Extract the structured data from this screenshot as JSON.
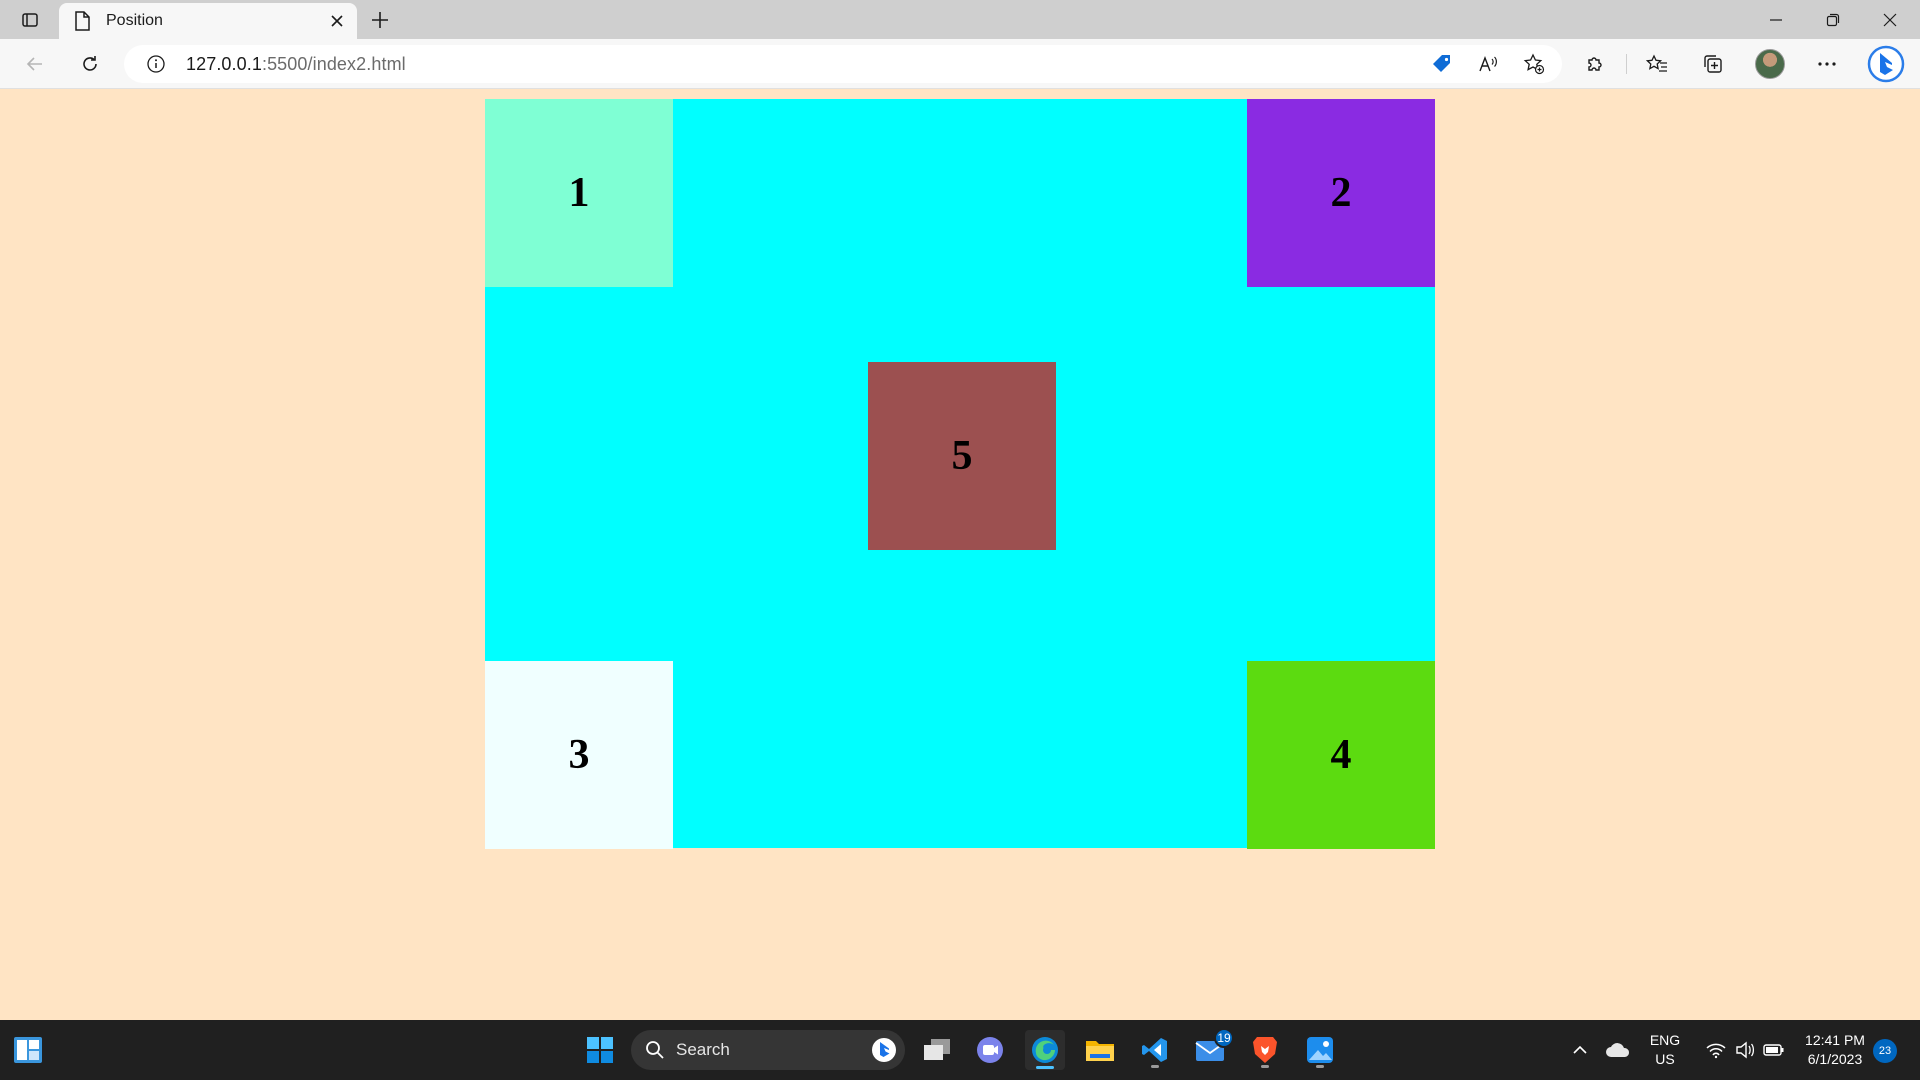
{
  "browser": {
    "tab": {
      "title": "Position"
    },
    "address": {
      "host": "127.0.0.1",
      "path": ":5500/index2.html"
    }
  },
  "page": {
    "background": "#ffe4c4",
    "container_color": "#00ffff",
    "boxes": [
      {
        "label": "1",
        "color": "#7fffd4"
      },
      {
        "label": "2",
        "color": "#8a2be2"
      },
      {
        "label": "3",
        "color": "#f0ffff"
      },
      {
        "label": "4",
        "color": "#5cdb10"
      },
      {
        "label": "5",
        "color": "#9c5050"
      }
    ]
  },
  "taskbar": {
    "search_label": "Search",
    "mail_badge": "19",
    "language": {
      "line1": "ENG",
      "line2": "US"
    },
    "clock": {
      "time": "12:41 PM",
      "date": "6/1/2023"
    },
    "notifications": "23"
  }
}
